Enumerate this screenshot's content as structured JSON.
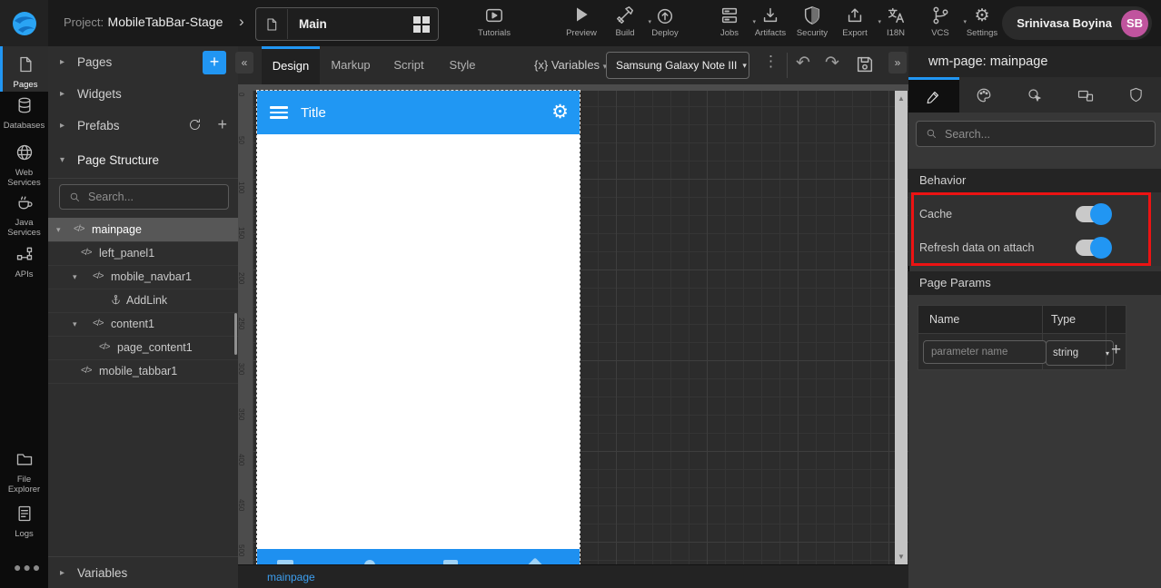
{
  "topbar": {
    "project_label": "Project:",
    "project_name": "MobileTabBar-Stage",
    "page_name": "Main",
    "actions": [
      {
        "label": "Tutorials"
      },
      {
        "label": "Preview"
      },
      {
        "label": "Build"
      },
      {
        "label": "Deploy"
      },
      {
        "label": "Jobs"
      },
      {
        "label": "Artifacts"
      },
      {
        "label": "Security"
      },
      {
        "label": "Export"
      },
      {
        "label": "I18N"
      },
      {
        "label": "VCS"
      },
      {
        "label": "Settings"
      }
    ],
    "user": {
      "name": "Srinivasa Boyina",
      "initials": "SB"
    }
  },
  "left_rail": {
    "items": [
      {
        "label": "Pages",
        "active": true
      },
      {
        "label": "Databases"
      },
      {
        "label": "Web Services"
      },
      {
        "label": "Java Services"
      },
      {
        "label": "APIs"
      },
      {
        "label": "File Explorer"
      },
      {
        "label": "Logs"
      }
    ]
  },
  "left_panel": {
    "sections": {
      "pages": "Pages",
      "widgets": "Widgets",
      "prefabs": "Prefabs",
      "page_structure": "Page Structure",
      "variables": "Variables"
    },
    "search_placeholder": "Search...",
    "tree": [
      {
        "label": "mainpage",
        "selected": true
      },
      {
        "label": "left_panel1"
      },
      {
        "label": "mobile_navbar1"
      },
      {
        "label": "AddLink"
      },
      {
        "label": "content1"
      },
      {
        "label": "page_content1"
      },
      {
        "label": "mobile_tabbar1"
      }
    ]
  },
  "editor": {
    "tabs": [
      {
        "label": "Design",
        "active": true
      },
      {
        "label": "Markup"
      },
      {
        "label": "Script"
      },
      {
        "label": "Style"
      }
    ],
    "variables_glyph": "{x}",
    "variables_label": "Variables",
    "device_value": "Samsung Galaxy Note III",
    "bottom_tab": "mainpage"
  },
  "canvas": {
    "phone_title": "Title",
    "ruler_values": [
      "0",
      "50",
      "100",
      "150",
      "200",
      "250",
      "300",
      "350",
      "400",
      "450",
      "500"
    ]
  },
  "right_panel": {
    "title": "wm-page: mainpage",
    "search_placeholder": "Search...",
    "behavior": {
      "title": "Behavior",
      "toggles": [
        {
          "label": "Cache",
          "on": true
        },
        {
          "label": "Refresh data on attach",
          "on": true
        }
      ]
    },
    "page_params": {
      "title": "Page Params",
      "columns": [
        "Name",
        "Type"
      ],
      "name_placeholder": "parameter name",
      "type_value": "string"
    }
  },
  "colors": {
    "accent": "#2196f3",
    "highlight_red": "#ec1313",
    "avatar": "#c0549e",
    "phone_header": "#2097f3"
  }
}
